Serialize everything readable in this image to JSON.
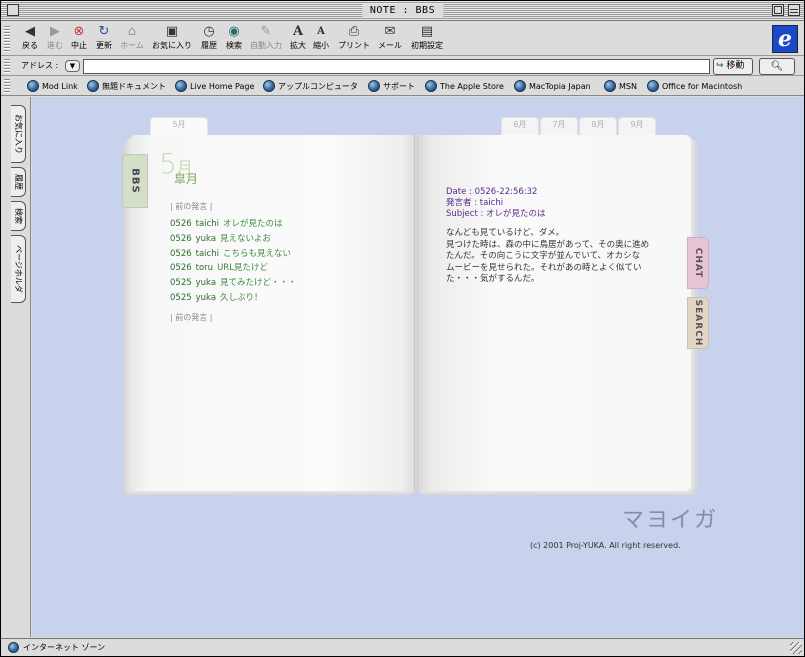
{
  "window": {
    "title": "NOTE : BBS"
  },
  "toolbar": {
    "buttons": [
      {
        "label": "戻る",
        "icon": "back-arrow-icon"
      },
      {
        "label": "進む",
        "icon": "forward-arrow-icon"
      },
      {
        "label": "中止",
        "icon": "stop-icon"
      },
      {
        "label": "更新",
        "icon": "refresh-icon"
      },
      {
        "label": "ホーム",
        "icon": "home-icon"
      },
      {
        "label": "お気に入り",
        "icon": "favorites-icon"
      },
      {
        "label": "履歴",
        "icon": "history-icon"
      },
      {
        "label": "検索",
        "icon": "search-icon"
      },
      {
        "label": "自動入力",
        "icon": "autofill-icon"
      },
      {
        "label": "拡大",
        "icon": "text-larger-icon"
      },
      {
        "label": "縮小",
        "icon": "text-smaller-icon"
      },
      {
        "label": "プリント",
        "icon": "print-icon"
      },
      {
        "label": "メール",
        "icon": "mail-icon"
      },
      {
        "label": "初期設定",
        "icon": "preferences-icon"
      }
    ]
  },
  "address": {
    "label": "アドレス :",
    "value": "",
    "go_label": "移動"
  },
  "favorites": [
    "Mod Link",
    "無題ドキュメント",
    "Live Home Page",
    "アップルコンピュータ",
    "サポート",
    "The Apple Store",
    "MacTopia Japan",
    "MSN",
    "Office for Macintosh"
  ],
  "side_tabs": [
    "お気に入り",
    "履歴",
    "検索",
    "ページホルダ"
  ],
  "status": {
    "text": "インターネット ゾーン"
  },
  "book": {
    "month_tabs_left": [
      "5月"
    ],
    "month_tabs_right": [
      "6月",
      "7月",
      "8月",
      "9月"
    ],
    "bbs_tab": "BBS",
    "chat_tab": "CHAT",
    "search_tab": "SEARCH",
    "month_number": "5",
    "month_unit": "月",
    "month_name": "皐月",
    "prev_label": "| 前の発言 |",
    "next_label": "| 前の発言 |",
    "posts": [
      {
        "date": "0526",
        "user": "taichi",
        "subject": "オレが見たのは"
      },
      {
        "date": "0526",
        "user": "yuka",
        "subject": "見えないよお"
      },
      {
        "date": "0526",
        "user": "taichi",
        "subject": "こちらも見えない"
      },
      {
        "date": "0526",
        "user": "toru",
        "subject": "URL見たけど"
      },
      {
        "date": "0525",
        "user": "yuka",
        "subject": "見てみたけど・・・"
      },
      {
        "date": "0525",
        "user": "yuka",
        "subject": "久しぶり！"
      }
    ],
    "detail": {
      "date": "Date : 0526-22:56:32",
      "speaker": "発言者 : taichi",
      "subject": "Subject : オレが見たのは",
      "body": "なんども見ているけど、ダメ。\n見つけた時は、森の中に鳥居があって、その奥に進め\nたんだ。その向こうに文字が並んでいて、オカシな\nムービーを見せられた。それがあの時とよく似てい\nた・・・気がするんだ。"
    },
    "signature": "マヨイガ",
    "copyright": "(c) 2001 Proj-YUKA. All right reserved."
  }
}
